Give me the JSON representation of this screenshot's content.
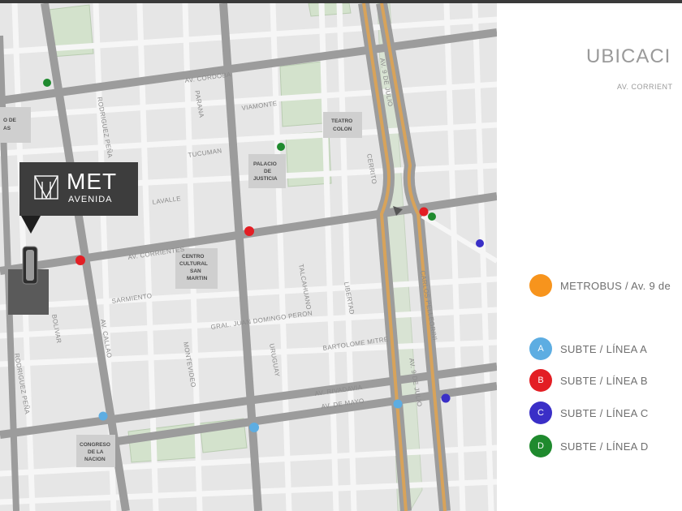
{
  "brand": {
    "name": "MET",
    "subtitle": "AVENIDA",
    "logo_icon": "met-monogram-icon"
  },
  "panel": {
    "title": "UBICACI",
    "address": "AV. CORRIENT"
  },
  "legend": [
    {
      "badge": "",
      "label": "METROBUS / Av. 9 de",
      "color": "#f7941d"
    },
    {
      "badge": "A",
      "label": "SUBTE / LÍNEA A",
      "color": "#5dade2"
    },
    {
      "badge": "B",
      "label": "SUBTE / LÍNEA B",
      "color": "#e31e24"
    },
    {
      "badge": "C",
      "label": "SUBTE / LÍNEA C",
      "color": "#3a2fc7"
    },
    {
      "badge": "D",
      "label": "SUBTE / LÍNEA D",
      "color": "#1f8a2e"
    }
  ],
  "map": {
    "streets": {
      "cordoba": "AV. CORDOBA",
      "corrientes": "AV. CORRIENTES",
      "rivadavia": "AV. RIVADAVIA",
      "de_mayo": "AV. DE MAYO",
      "nueve_julio_north": "AV. 9 DE JULIO",
      "nueve_julio_south": "AV. 9 DE JULIO",
      "callao": "AV. CALLAO",
      "rodriguez_pena": "RODRIGUEZ PEÑA",
      "parana": "PARANA",
      "uruguay": "URUGUAY",
      "talcahuano": "TALCAHUANO",
      "libertad": "LIBERTAD",
      "montevideo": "MONTEVIDEO",
      "bolivar": "BOLIVAR",
      "rodriguez_pena_s": "RODRIGUEZ PEÑA",
      "viamonte": "VIAMONTE",
      "tucuman": "TUCUMAN",
      "lavalle": "LAVALLE",
      "sarmiento": "SARMIENTO",
      "peron": "GRAL. JUAN DOMINGO PERON",
      "mitre": "BARTOLOME MITRE",
      "cerrito": "CERRITO",
      "pellegrini": "CARLOS PELLEGRINI"
    },
    "landmarks": {
      "teatro_colon": [
        "TEATRO",
        "COLON"
      ],
      "palacio": [
        "PALACIO",
        "DE",
        "JUSTICIA"
      ],
      "centro": [
        "CENTRO",
        "CULTURAL",
        "SAN",
        "MARTIN"
      ],
      "congreso": [
        "CONGRESO",
        "DE LA",
        "NACION"
      ],
      "left_label": [
        "O DE",
        "AS"
      ]
    },
    "station_icons": [
      "metrobus-station-icon",
      "subte-station-icon"
    ]
  }
}
